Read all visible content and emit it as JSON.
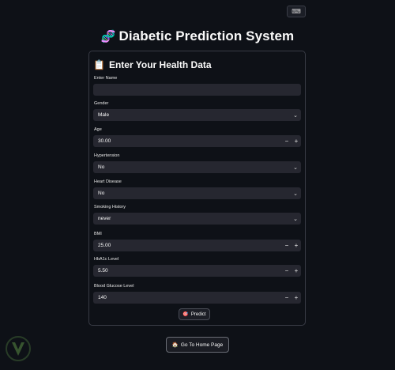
{
  "top_button": {
    "icon": "keyboard-icon"
  },
  "header": {
    "emoji": "🧬",
    "title": "Diabetic Prediction System"
  },
  "form": {
    "emoji": "📋",
    "title": "Enter Your Health Data",
    "fields": {
      "name": {
        "label": "Enter Name",
        "value": ""
      },
      "gender": {
        "label": "Gender",
        "value": "Male"
      },
      "age": {
        "label": "Age",
        "value": "30.00"
      },
      "hypertension": {
        "label": "Hypertension",
        "value": "No"
      },
      "heart_disease": {
        "label": "Heart Disease",
        "value": "No"
      },
      "smoking": {
        "label": "Smoking History",
        "value": "never"
      },
      "bmi": {
        "label": "BMI",
        "value": "25.00"
      },
      "hba1c": {
        "label": "HbA1c Level",
        "value": "5.50"
      },
      "glucose": {
        "label": "Blood Glucose Level",
        "value": "140"
      }
    },
    "stepper": {
      "minus": "−",
      "plus": "+"
    },
    "predict": {
      "emoji": "🎯",
      "label": "Predict"
    }
  },
  "home_button": {
    "emoji": "🏠",
    "label": "Go To Home Page"
  }
}
